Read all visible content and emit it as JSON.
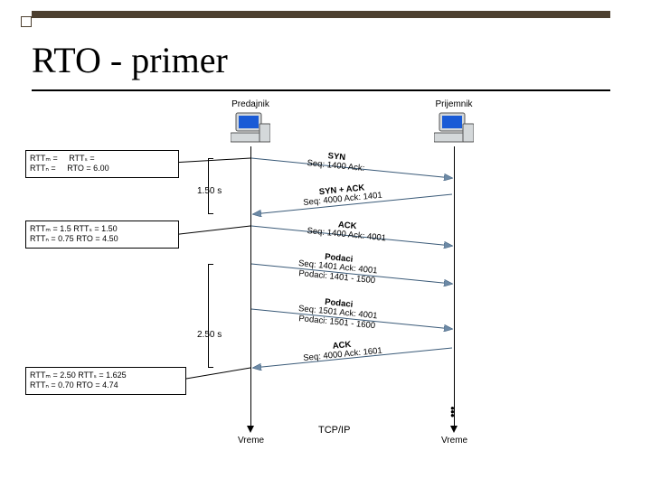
{
  "title": "RTO - primer",
  "sender": {
    "label": "Predajnik"
  },
  "receiver": {
    "label": "Prijemnik"
  },
  "axis": {
    "time": "Vreme"
  },
  "footer": "TCP/IP",
  "times": {
    "t1": "1.50 s",
    "t2": "2.50 s"
  },
  "rtt": {
    "box1": {
      "l1": "RTTₘ =",
      "l2": "RTTₙ =",
      "l3": "RTTₛ =",
      "l4": "RTO = 6.00"
    },
    "box2": {
      "l1": "RTTₘ = 1.5   RTTₛ = 1.50",
      "l2": "RTTₙ = 0.75  RTO = 4.50"
    },
    "box3": {
      "l1": "RTTₘ = 2.50  RTTₛ = 1.625",
      "l2": "RTTₙ = 0.70  RTO = 4.74"
    }
  },
  "msgs": {
    "syn": {
      "t": "SYN",
      "d": "Seq: 1400  Ack:"
    },
    "synack": {
      "t": "SYN + ACK",
      "d": "Seq: 4000  Ack: 1401"
    },
    "ack": {
      "t": "ACK",
      "d": "Seq: 1400  Ack: 4001"
    },
    "data1": {
      "t": "Podaci",
      "d1": "Seq: 1401  Ack: 4001",
      "d2": "Podaci: 1401 - 1500"
    },
    "data2": {
      "t": "Podaci",
      "d1": "Seq: 1501  Ack: 4001",
      "d2": "Podaci: 1501 - 1600"
    },
    "ack2": {
      "t": "ACK",
      "d": "Seq: 4000  Ack: 1601"
    }
  },
  "colors": {
    "screen": "#1a5bd6",
    "body": "#d4d8da",
    "arrow": "#6d8aa6"
  }
}
